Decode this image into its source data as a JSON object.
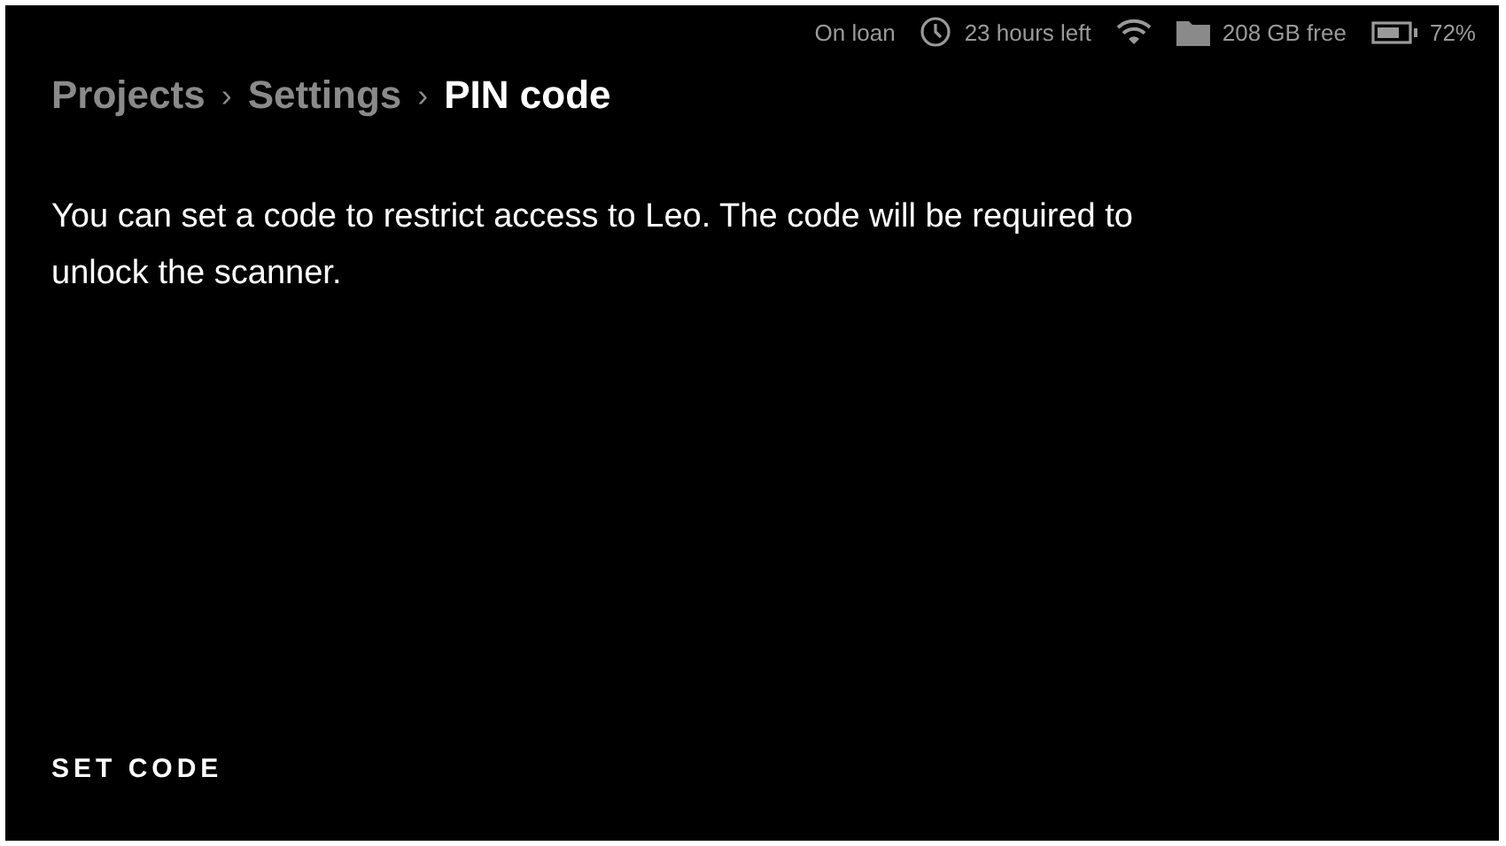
{
  "status_bar": [
    {
      "kind": "text",
      "label": "On loan"
    },
    {
      "kind": "clock",
      "label": "23 hours left"
    },
    {
      "kind": "wifi"
    },
    {
      "kind": "folder",
      "label": "208 GB free"
    },
    {
      "kind": "battery",
      "label": "72%"
    }
  ],
  "breadcrumb": {
    "items": [
      {
        "label": "Projects",
        "current": false
      },
      {
        "label": "Settings",
        "current": false
      },
      {
        "label": "PIN code",
        "current": true
      }
    ],
    "separators": [
      "›",
      "›"
    ]
  },
  "description": "You can set a code to restrict access to Leo. The code will be required to unlock the scanner.",
  "action_button": "SET CODE"
}
